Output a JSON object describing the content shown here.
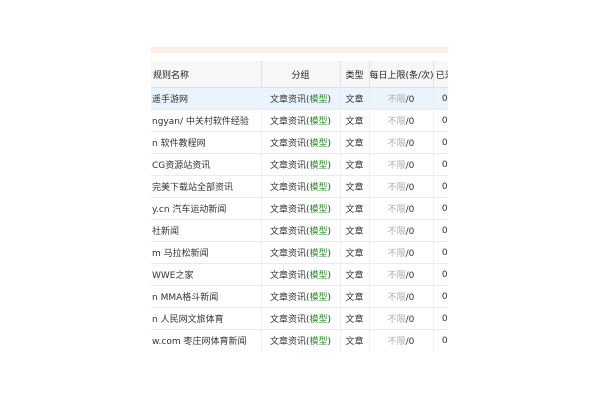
{
  "header": {
    "name": "规则名称",
    "group": "分组",
    "type": "类型",
    "daily_limit": "每日上限(条/次)",
    "collected": "已采"
  },
  "rows": [
    {
      "name": "遥手游网",
      "group": "文章资讯",
      "model": "模型",
      "type": "文章",
      "limit": "不限",
      "used": "/0",
      "collected": "0",
      "selected": true
    },
    {
      "name": "ngyan/ 中关村软件经验",
      "group": "文章资讯",
      "model": "模型",
      "type": "文章",
      "limit": "不限",
      "used": "/0",
      "collected": "0"
    },
    {
      "name": "n 软件教程网",
      "group": "文章资讯",
      "model": "模型",
      "type": "文章",
      "limit": "不限",
      "used": "/0",
      "collected": "0"
    },
    {
      "name": "CG资源站资讯",
      "group": "文章资讯",
      "model": "模型",
      "type": "文章",
      "limit": "不限",
      "used": "/0",
      "collected": "0"
    },
    {
      "name": "完美下载站全部资讯",
      "group": "文章资讯",
      "model": "模型",
      "type": "文章",
      "limit": "不限",
      "used": "/0",
      "collected": "0"
    },
    {
      "name": "y.cn 汽车运动新闻",
      "group": "文章资讯",
      "model": "模型",
      "type": "文章",
      "limit": "不限",
      "used": "/0",
      "collected": "0"
    },
    {
      "name": "社新闻",
      "group": "文章资讯",
      "model": "模型",
      "type": "文章",
      "limit": "不限",
      "used": "/0",
      "collected": "0"
    },
    {
      "name": "m 马拉松新闻",
      "group": "文章资讯",
      "model": "模型",
      "type": "文章",
      "limit": "不限",
      "used": "/0",
      "collected": "0"
    },
    {
      "name": "WWE之家",
      "group": "文章资讯",
      "model": "模型",
      "type": "文章",
      "limit": "不限",
      "used": "/0",
      "collected": "0"
    },
    {
      "name": "n MMA格斗新闻",
      "group": "文章资讯",
      "model": "模型",
      "type": "文章",
      "limit": "不限",
      "used": "/0",
      "collected": "0"
    },
    {
      "name": "n 人民网文旅体育",
      "group": "文章资讯",
      "model": "模型",
      "type": "文章",
      "limit": "不限",
      "used": "/0",
      "collected": "0"
    },
    {
      "name": "w.com 枣庄网体育新闻",
      "group": "文章资讯",
      "model": "模型",
      "type": "文章",
      "limit": "不限",
      "used": "/0",
      "collected": "0"
    }
  ]
}
